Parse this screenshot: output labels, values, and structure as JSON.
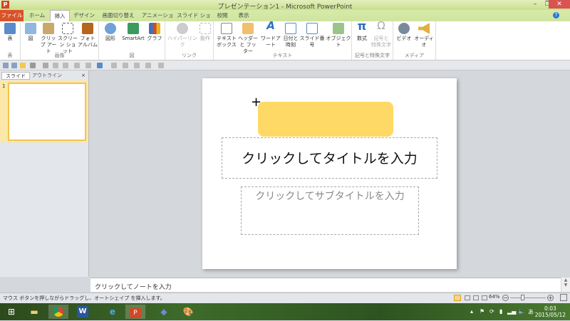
{
  "window": {
    "title": "プレゼンテーション1 - Microsoft PowerPoint",
    "app_icon": "P",
    "minimize": "–",
    "restore": "❐",
    "close": "✕"
  },
  "tabs": [
    "ファイル",
    "ホーム",
    "挿入",
    "デザイン",
    "画面切り替え",
    "アニメーション",
    "スライド ショー",
    "校閲",
    "表示"
  ],
  "ribbon": {
    "groups": [
      {
        "label": "表",
        "buttons": [
          "表"
        ]
      },
      {
        "label": "画像",
        "buttons": [
          "図",
          "クリップ アート",
          "スクリーン ショット",
          "フォト アルバム"
        ]
      },
      {
        "label": "図",
        "buttons": [
          "図形",
          "SmartArt",
          "グラフ"
        ]
      },
      {
        "label": "リンク",
        "buttons": [
          "ハイパーリンク",
          "動作"
        ]
      },
      {
        "label": "テキスト",
        "buttons": [
          "テキスト ボックス",
          "ヘッダーと フッター",
          "ワードアート",
          "日付と 時刻",
          "スライド番号",
          "オブジェクト"
        ]
      },
      {
        "label": "記号と特殊文字",
        "buttons": [
          "数式",
          "記号と 特殊文字"
        ]
      },
      {
        "label": "メディア",
        "buttons": [
          "ビデオ",
          "オーディオ"
        ]
      }
    ]
  },
  "left_pane": {
    "tabs": [
      "スライド",
      "アウトライン"
    ],
    "close": "×",
    "slide_number": "1"
  },
  "slide": {
    "title_placeholder": "クリックしてタイトルを入力",
    "subtitle_placeholder": "クリックしてサブタイトルを入力",
    "shape_color": "#ffd966"
  },
  "notes": {
    "placeholder": "クリックしてノートを入力"
  },
  "status": {
    "message": "マウス ボタンを押しながらドラッグし、オートシェイプ を挿入します。",
    "zoom": "64%",
    "zoom_minus": "−",
    "zoom_plus": "+"
  },
  "taskbar": {
    "time": "0:03",
    "date": "2015/05/12",
    "ime": "あ"
  }
}
